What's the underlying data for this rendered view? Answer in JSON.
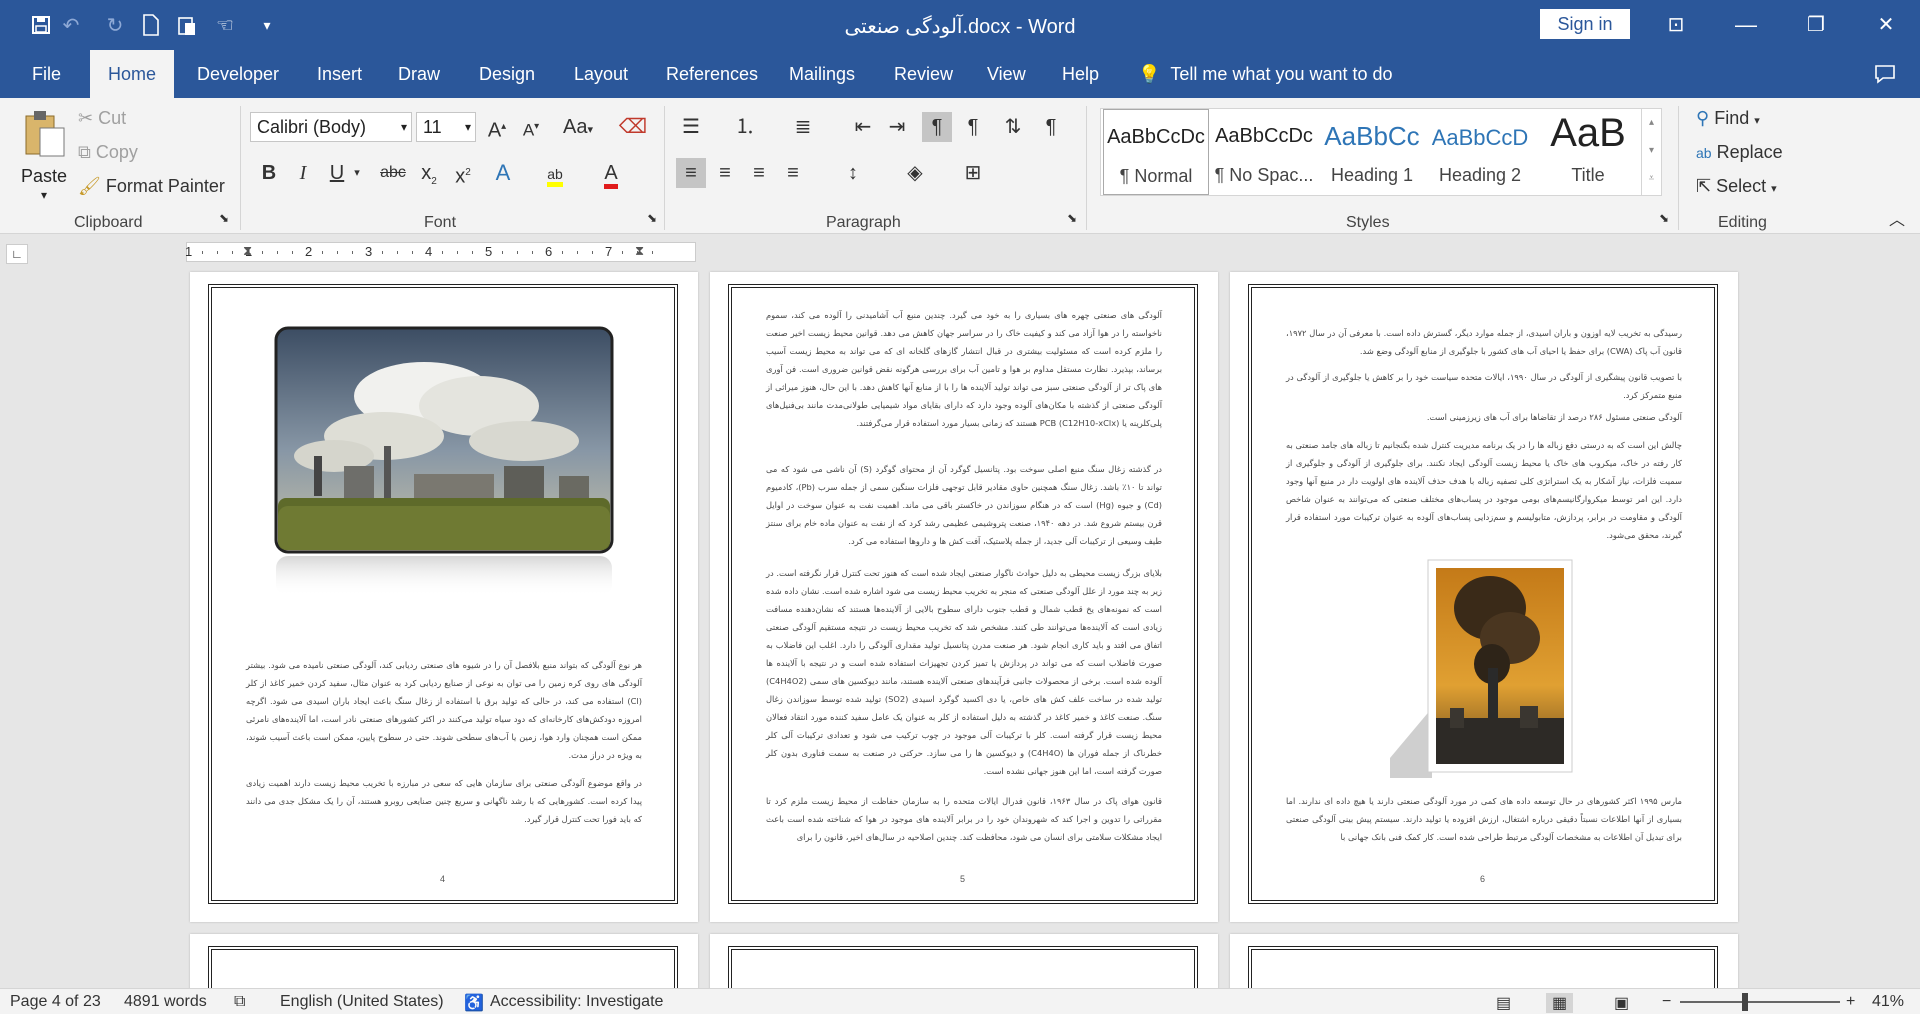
{
  "window": {
    "title": "آلودگی صنعتی.docx - Word",
    "sign_in": "Sign in"
  },
  "tabs": [
    "File",
    "Home",
    "Developer",
    "Insert",
    "Draw",
    "Design",
    "Layout",
    "References",
    "Mailings",
    "Review",
    "View",
    "Help"
  ],
  "tell_me": "Tell me what you want to do",
  "clipboard": {
    "paste": "Paste",
    "cut": "Cut",
    "copy": "Copy",
    "format_painter": "Format Painter",
    "label": "Clipboard"
  },
  "font": {
    "family": "Calibri (Body)",
    "size": "11",
    "label": "Font",
    "aa": "Aa"
  },
  "paragraph": {
    "label": "Paragraph"
  },
  "styles": {
    "label": "Styles",
    "items": [
      {
        "preview": "AaBbCcDc",
        "name": "¶ Normal"
      },
      {
        "preview": "AaBbCcDc",
        "name": "¶ No Spac..."
      },
      {
        "preview": "AaBbCc",
        "name": "Heading 1"
      },
      {
        "preview": "AaBbCcD",
        "name": "Heading 2"
      },
      {
        "preview": "AaB",
        "name": "Title"
      }
    ]
  },
  "editing": {
    "find": "Find",
    "replace": "Replace",
    "select": "Select",
    "label": "Editing"
  },
  "ruler": {
    "numbers": [
      "1",
      "1",
      "2",
      "3",
      "4",
      "5",
      "6",
      "7"
    ]
  },
  "pages": {
    "p4": {
      "number": "4",
      "para1": "هر نوع آلودگی که بتواند منبع بلافصل آن را در شیوه های صنعتی ردیابی کند، آلودگی صنعتی نامیده می شود. بیشتر آلودگی های روی کره زمین را می توان به نوعی از صنایع ردیابی کرد به عنوان مثال، سفید کردن خمیر کاغذ از کلر (Cl) استفاده می کند، در حالی که تولید برق با استفاده از زغال سنگ باعث ایجاد باران اسیدی می شود. اگرچه امروزه دودکش‌های کارخانه‌ای که دود سیاه تولید می‌کنند در اکثر کشورهای صنعتی نادر است، اما آلاینده‌های نامرئی ممکن است همچنان وارد هوا، زمین یا آب‌های سطحی شوند. حتی در سطوح پایین، ممکن است باعث آسیب شوند، به ویژه در دراز مدت.",
      "para2": "در واقع موضوع آلودگی صنعتی برای سازمان هایی که سعی در مبارزه با تخریب محیط زیست دارند اهمیت زیادی پیدا کرده است. کشورهایی که با رشد ناگهانی و سریع چنین صنایعی روبرو هستند، آن را یک مشکل جدی می دانند که باید فورا تحت کنترل قرار گیرد."
    },
    "p5": {
      "number": "5",
      "para1": "آلودگی های صنعتی چهره های بسیاری را به خود می گیرد. چندین منبع آب آشامیدنی را آلوده می کند، سموم ناخواسته را در هوا آزاد می کند و کیفیت خاک را در سراسر جهان کاهش می دهد. قوانین محیط زیست اخیر صنعت را ملزم کرده است که مسئولیت بیشتری در قبال انتشار گازهای گلخانه ای که می تواند به محیط زیست آسیب برساند، بپذیرد. نظارت مستقل مداوم بر هوا و تامین آب برای بررسی هرگونه نقض قوانین ضروری است. فن آوری های پاک تر از آلودگی صنعتی سبز می تواند تولید آلاینده ها را با از منابع آنها کاهش دهد. با این حال، هنوز میراثی از آلودگی صنعتی از گذشته با مکان‌های آلوده وجود دارد که دارای بقایای مواد شیمیایی طولانی‌مدت مانند بی‌فنیل‌های پلی‌کلرینه یا PCB (C12H10-xClx) هستند که زمانی بسیار مورد استفاده قرار می‌گرفتند.",
      "para2": "در گذشته زغال سنگ منبع اصلی سوخت بود. پتانسیل گوگرد آن از محتوای گوگرد (S) آن ناشی می شود که می تواند تا ۱۰٪ باشد. زغال سنگ همچنین حاوی مقادیر قابل توجهی فلزات سنگین سمی از جمله سرب (Pb)، کادمیوم (Cd) و جیوه (Hg) است که در هنگام سوزاندن در خاکستر باقی می ماند. اهمیت نفت به عنوان سوخت در اوایل قرن بیستم شروع شد. در دهه ۱۹۴۰، صنعت پتروشیمی عظیمی رشد کرد که از نفت به عنوان ماده خام برای سنتز طیف وسیعی از ترکیبات آلی جدید، از جمله پلاستیک، آفت کش ها و داروها استفاده می کرد.",
      "para3": "بلایای بزرگ زیست محیطی به دلیل حوادث ناگوار صنعتی ایجاد شده است که هنوز تحت کنترل قرار نگرفته است. در زیر به چند مورد از علل آلودگی صنعتی که منجر به تخریب محیط زیست می شود اشاره شده است. نشان داده شده است که نمونه‌های یخ قطب شمال و قطب جنوب دارای سطوح بالایی از آلاینده‌ها هستند که نشان‌دهنده مسافت زیادی است که آلاینده‌ها می‌توانند طی کنند. مشخص شد که تخریب محیط زیست در نتیجه مستقیم آلودگی صنعتی اتفاق می افتد و باید کاری انجام شود. هر صنعت مدرن پتانسیل تولید مقداری آلودگی را دارد. اغلب این فاضلاب به صورت فاضلاب است که می تواند در پردازش یا تمیز کردن تجهیزات استفاده شده است و در نتیجه با آلاینده ها آلوده شده است. برخی از محصولات جانبی فرآیندهای صنعتی آلاینده هستند، مانند دیوکسین های سمی (C4H4O2) تولید شده در ساخت علف کش های خاص، یا دی اکسید گوگرد اسیدی (SO2) تولید شده توسط سوزاندن زغال سنگ. صنعت کاغذ و خمیر کاغذ در گذشته به دلیل استفاده از کلر به عنوان یک عامل سفید کننده مورد انتقاد فعالان محیط زیست قرار گرفته است. کلر با ترکیبات آلی موجود در چوب ترکیب می شود و تعدادی ترکیبات آلی کلر خطرناک از جمله فوران ها (C4H4O) و دیوکسین ها را می سازد. حرکتی در صنعت به سمت فناوری بدون کلر صورت گرفته است، اما این هنوز جهانی نشده است.",
      "para4": "قانون هوای پاک در سال ۱۹۶۳، قانون فدرال ایالات متحده را به سازمان حفاظت از محیط زیست ملزم کرد تا مقرراتی را تدوین و اجرا کند که شهروندان خود را در برابر آلاینده های موجود در هوا که شناخته شده است باعث ایجاد مشکلات سلامتی برای انسان می شود، محافظت کند. چندین اصلاحیه در سال‌های اخیر، قانون را برای"
    },
    "p6": {
      "number": "6",
      "para1": "رسیدگی به تخریب لایه اوزون و باران اسیدی، از جمله موارد دیگر، گسترش داده است. با معرفی آن در سال ۱۹۷۲، قانون آب پاک (CWA) برای حفظ یا احیای آب های کشور با جلوگیری از منابع آلودگی وضع شد.",
      "para2": "با تصویب قانون پیشگیری از آلودگی در سال ۱۹۹۰، ایالات متحده سیاست خود را بر کاهش یا جلوگیری از آلودگی در منبع متمرکز کرد.",
      "para3": "آلودگی صنعتی مسئول ۲۸۶ درصد از تقاضاها برای آب های زیرزمینی است.",
      "para4": "چالش این است که به درستی دفع زباله ها را در یک برنامه مدیریت کنترل شده بگنجانیم تا زباله های جامد صنعتی به کار رفته در خاک، میکروب های خاک یا محیط زیست آلودگی ایجاد نکنند. برای جلوگیری از آلودگی و جلوگیری از سمیت فلزات، نیاز آشکار به یک استراتژی کلی تصفیه زباله با هدف حذف آلاینده های اولویت دار در منبع آنها وجود دارد. این امر توسط میکروارگانیسم‌های بومی موجود در پساب‌های مختلف صنعتی که می‌توانند به عنوان شاخص آلودگی و مقاومت در برابر، پردازش، متابولیسم و سم‌زدایی پساب‌های آلوده به عنوان ترکیبات مورد استفاده قرار گیرند، محقق می‌شود.",
      "para5": "مارس ۱۹۹۵ اکثر کشورهای در حال توسعه داده های کمی در مورد آلودگی صنعتی دارند یا هیچ داده ای ندارند. اما بسیاری از آنها اطلاعات نسبتاً دقیقی درباره اشتغال، ارزش افزوده یا تولید دارند. سیستم پیش بینی آلودگی صنعتی برای تبدیل آن اطلاعات به مشخصات آلودگی مرتبط طراحی شده است. کار کمک فنی بانک جهانی با"
    }
  },
  "status": {
    "page": "Page 4 of 23",
    "words": "4891 words",
    "language": "English (United States)",
    "accessibility": "Accessibility: Investigate",
    "zoom": "41%"
  }
}
